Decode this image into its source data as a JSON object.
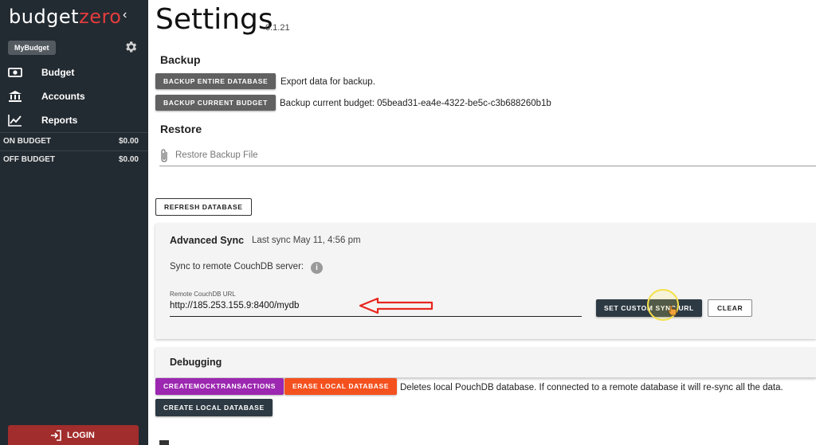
{
  "sidebar": {
    "logo_part1": "budget",
    "logo_part2": "zero",
    "collapse_icon": "chevron-left-icon",
    "budget_chip": "MyBudget",
    "settings_icon": "gear-icon",
    "nav": [
      {
        "label": "Budget",
        "icon": "money-icon"
      },
      {
        "label": "Accounts",
        "icon": "bank-icon"
      },
      {
        "label": "Reports",
        "icon": "chart-line-icon"
      }
    ],
    "accounts": [
      {
        "name": "ON BUDGET",
        "value": "$0.00"
      },
      {
        "name": "OFF BUDGET",
        "value": "$0.00"
      }
    ],
    "login_label": "LOGIN",
    "login_icon": "login-icon"
  },
  "main": {
    "title": "Settings",
    "version": "0.1.21",
    "backup": {
      "heading": "Backup",
      "entire_db_button": "BACKUP ENTIRE DATABASE",
      "entire_db_desc": "Export data for backup.",
      "current_budget_button": "BACKUP CURRENT BUDGET",
      "current_budget_desc": "Backup current budget: 05bead31-ea4e-4322-be5c-c3b688260b1b"
    },
    "restore": {
      "heading": "Restore",
      "placeholder": "Restore Backup File"
    },
    "refresh_button": "REFRESH DATABASE",
    "sync": {
      "heading": "Advanced Sync",
      "last_sync": "Last sync May 11, 4:56 pm",
      "remote_label": "Sync to remote CouchDB server:",
      "url_label": "Remote CouchDB URL",
      "url_value": "http://185.253.155.9:8400/mydb",
      "set_button": "SET CUSTOM SYNC URL",
      "clear_button": "CLEAR"
    },
    "debugging": {
      "heading": "Debugging",
      "mock_button": "CREATEMOCKTRANSACTIONS",
      "erase_button": "ERASE LOCAL DATABASE",
      "erase_desc": "Deletes local PouchDB database. If connected to a remote database it will re-sync all the data.",
      "create_button": "CREATE LOCAL DATABASE"
    }
  },
  "colors": {
    "sidebar_bg": "#232b32",
    "logo_accent": "#e23c3c",
    "login_bg": "#a12d2c",
    "purple": "#9c27b0",
    "orange": "#f4511e",
    "navy": "#2d3a43",
    "annotation_arrow": "#e8261e"
  }
}
